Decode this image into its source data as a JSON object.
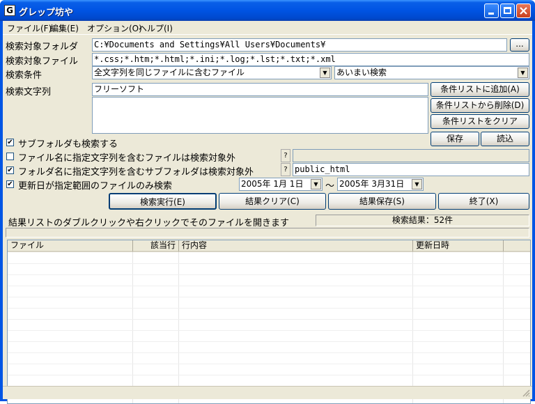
{
  "window": {
    "title": "グレップ坊や",
    "icon_letter": "G"
  },
  "menu": {
    "items": [
      "ファイル(F)",
      "編集(E)",
      "オプション(O)",
      "ヘルプ(I)"
    ]
  },
  "form": {
    "folder_label": "検索対象フォルダ",
    "folder_value": "C:¥Documents and Settings¥All Users¥Documents¥",
    "browse_label": "...",
    "file_label": "検索対象ファイル",
    "file_value": "*.css;*.htm;*.html;*.ini;*.log;*.lst;*.txt;*.xml",
    "condition_label": "検索条件",
    "condition_value": "全文字列を同じファイルに含むファイル",
    "mode_value": "あいまい検索",
    "search_label": "検索文字列",
    "search_value": "フリーソフト"
  },
  "side_buttons": {
    "add": "条件リストに追加(A)",
    "remove": "条件リストから削除(D)",
    "clear": "条件リストをクリア",
    "save": "保存",
    "load": "読込"
  },
  "options": {
    "subfolder": {
      "label": "サブフォルダも検索する",
      "checked": true
    },
    "exclude_file": {
      "label": "ファイル名に指定文字列を含むファイルは検索対象外",
      "checked": false,
      "q": "?",
      "value": ""
    },
    "exclude_folder": {
      "label": "フォルダ名に指定文字列を含むサブフォルダは検索対象外",
      "checked": true,
      "q": "?",
      "value": "public_html"
    },
    "date_range": {
      "label": "更新日が指定範囲のファイルのみ検索",
      "checked": true,
      "from": "2005年  1月  1日",
      "to": "2005年  3月31日",
      "sep": "～"
    }
  },
  "actions": {
    "run": "検索実行(E)",
    "clear": "結果クリア(C)",
    "save": "結果保存(S)",
    "exit": "終了(X)"
  },
  "status": {
    "hint": "結果リストのダブルクリックや右クリックでそのファイルを開きます",
    "result": "検索結果：52件"
  },
  "list": {
    "columns": [
      "ファイル",
      "該当行",
      "行内容",
      "更新日時"
    ]
  }
}
